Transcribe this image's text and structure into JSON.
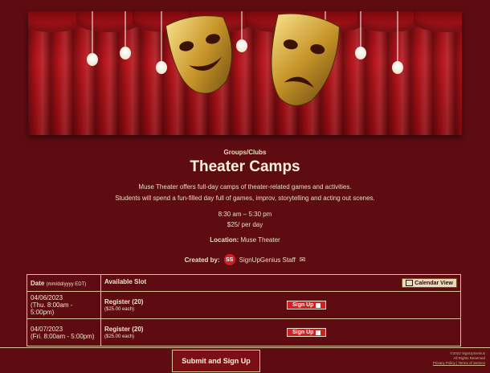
{
  "category": "Groups/Clubs",
  "title": "Theater Camps",
  "description": {
    "line1": "Muse Theater offers full-day camps of theater-related games and activities.",
    "line2": "Students will spend a fun-filled day full of games, improv, storytelling and acting out scenes."
  },
  "schedule": {
    "time": "8:30 am – 5:30 pm",
    "price": "$25/ per day"
  },
  "location": {
    "label": "Location:",
    "value": "Muse Theater"
  },
  "creator": {
    "label": "Created by:",
    "initials": "SS",
    "name": "SignUpGenius Staff",
    "icon": "mail-icon"
  },
  "table": {
    "date_header": "Date",
    "date_format": "(mm/dd/yyyy EDT)",
    "slot_header": "Available Slot",
    "calendar_button": "Calendar View",
    "rows": [
      {
        "date": "04/06/2023",
        "time": "(Thu. 8:00am - 5:00pm)",
        "slot": "Register (20)",
        "price": "($25.00 each)",
        "button": "Sign Up"
      },
      {
        "date": "04/07/2023",
        "time": "(Fri. 8:00am - 5:00pm)",
        "slot": "Register (20)",
        "price": "($25.00 each)",
        "button": "Sign Up"
      }
    ]
  },
  "footer": {
    "submit": "Submit and Sign Up",
    "copyright": "©2022 SignUpGenius",
    "rights": "All Rights Reserved",
    "privacy": "Privacy Policy",
    "terms": "Terms of Service"
  },
  "colors": {
    "background": "#5e0c12",
    "accent": "#d11f26",
    "border": "#d7c49a",
    "text": "#f3e6c8"
  }
}
